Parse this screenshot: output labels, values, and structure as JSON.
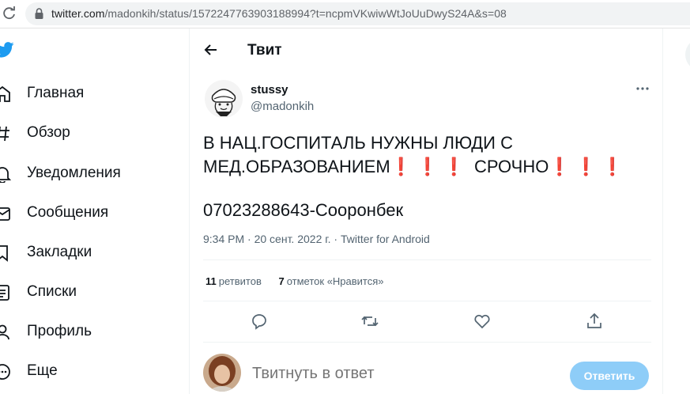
{
  "browser": {
    "url_host": "twitter.com",
    "url_path": "/madonkih/status/1572247763903188994?t=ncpmVKwiwWtJoUuDwyS24A&s=08"
  },
  "sidebar": {
    "items": [
      {
        "label": "Главная",
        "icon": "home-icon"
      },
      {
        "label": "Обзор",
        "icon": "hashtag-icon"
      },
      {
        "label": "Уведомления",
        "icon": "bell-icon"
      },
      {
        "label": "Сообщения",
        "icon": "envelope-icon"
      },
      {
        "label": "Закладки",
        "icon": "bookmark-icon"
      },
      {
        "label": "Списки",
        "icon": "list-icon"
      },
      {
        "label": "Профиль",
        "icon": "person-icon"
      },
      {
        "label": "Еще",
        "icon": "more-circle-icon"
      }
    ]
  },
  "header": {
    "title": "Твит"
  },
  "tweet": {
    "author_name": "stussy",
    "author_handle": "@madonkih",
    "text_line1": "В НАЦ.ГОСПИТАЛЬ НУЖНЫ ЛЮДИ С",
    "text_line2_a": "МЕД.ОБРАЗОВАНИЕМ",
    "emoji_1": "❗❗❗",
    "text_line2_b": " СРОЧНО",
    "emoji_2": "❗❗❗",
    "phone_line": "07023288643-Сооронбек",
    "time": "9:34 PM",
    "date": "20 сент. 2022 г.",
    "source": "Twitter for Android",
    "separator": " · "
  },
  "stats": {
    "retweets_count": "11",
    "retweets_label": "ретвитов",
    "likes_count": "7",
    "likes_label": "отметок «Нравится»"
  },
  "reply": {
    "placeholder": "Твитнуть в ответ",
    "button_label": "Ответить"
  },
  "colors": {
    "accent": "#1d9bf0",
    "reply_button_disabled": "#8ecdf8",
    "secondary_text": "#536471",
    "emoji_red": "#d0122e"
  }
}
